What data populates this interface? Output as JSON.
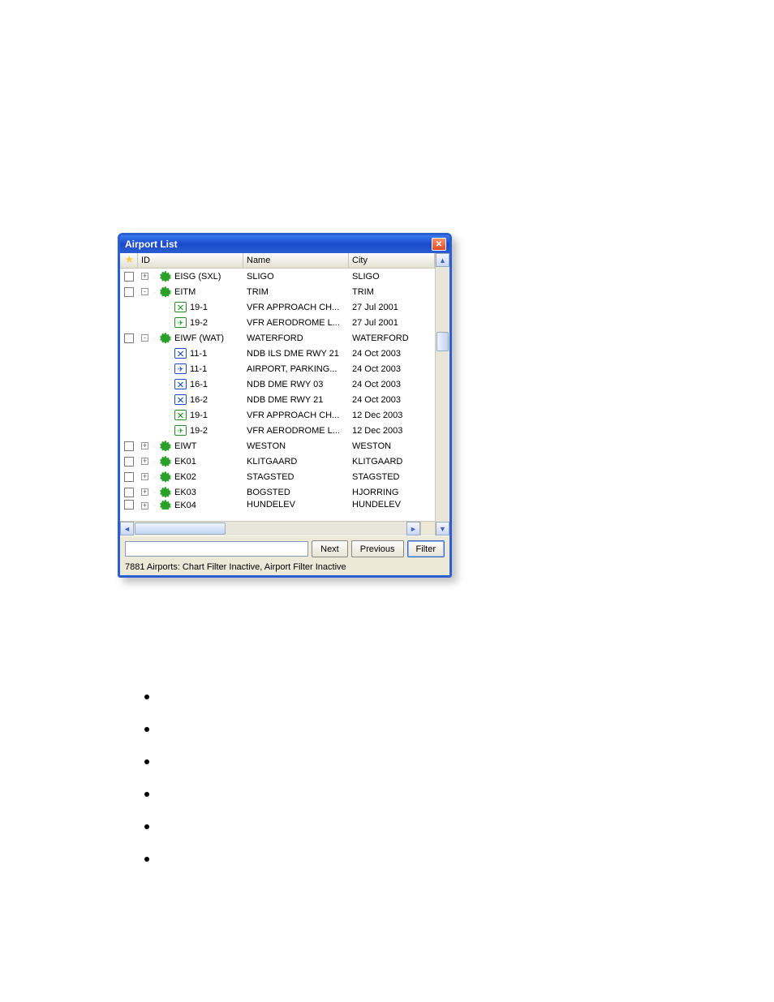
{
  "title": "Airport List",
  "columns": {
    "star": "",
    "id": "ID",
    "name": "Name",
    "city": "City"
  },
  "rows": [
    {
      "type": "airport",
      "exp": "+",
      "id": "EISG (SXL)",
      "name": "SLIGO",
      "city": "SLIGO"
    },
    {
      "type": "airport",
      "exp": "-",
      "id": "EITM",
      "name": "TRIM",
      "city": "TRIM"
    },
    {
      "type": "chart",
      "icon": "green",
      "id": "19-1",
      "name": "VFR APPROACH CH...",
      "city": "27 Jul 2001"
    },
    {
      "type": "chart",
      "icon": "green-apt",
      "id": "19-2",
      "name": "VFR AERODROME L...",
      "city": "27 Jul 2001"
    },
    {
      "type": "airport",
      "exp": "-",
      "id": "EIWF (WAT)",
      "name": "WATERFORD",
      "city": "WATERFORD"
    },
    {
      "type": "chart",
      "icon": "blue",
      "id": "11-1",
      "name": "NDB ILS DME RWY 21",
      "city": "24 Oct 2003"
    },
    {
      "type": "chart",
      "icon": "blue-apt",
      "id": "11-1",
      "name": "AIRPORT, PARKING...",
      "city": "24 Oct 2003"
    },
    {
      "type": "chart",
      "icon": "blue",
      "id": "16-1",
      "name": "NDB DME RWY 03",
      "city": "24 Oct 2003"
    },
    {
      "type": "chart",
      "icon": "blue",
      "id": "16-2",
      "name": "NDB DME RWY 21",
      "city": "24 Oct 2003"
    },
    {
      "type": "chart",
      "icon": "green",
      "id": "19-1",
      "name": "VFR APPROACH CH...",
      "city": "12 Dec 2003"
    },
    {
      "type": "chart",
      "icon": "green-apt",
      "id": "19-2",
      "name": "VFR AERODROME L...",
      "city": "12 Dec 2003"
    },
    {
      "type": "airport",
      "exp": "+",
      "id": "EIWT",
      "name": "WESTON",
      "city": "WESTON"
    },
    {
      "type": "airport",
      "exp": "+",
      "id": "EK01",
      "name": "KLITGAARD",
      "city": "KLITGAARD"
    },
    {
      "type": "airport",
      "exp": "+",
      "id": "EK02",
      "name": "STAGSTED",
      "city": "STAGSTED"
    },
    {
      "type": "airport",
      "exp": "+",
      "id": "EK03",
      "name": "BOGSTED",
      "city": "HJORRING"
    },
    {
      "type": "airport",
      "exp": "+",
      "id": "EK04",
      "name": "HUNDELEV",
      "city": "HUNDELEV",
      "cut": true
    }
  ],
  "buttons": {
    "next": "Next",
    "previous": "Previous",
    "filter": "Filter"
  },
  "search_value": "",
  "status": "7881 Airports: Chart Filter Inactive, Airport Filter Inactive"
}
